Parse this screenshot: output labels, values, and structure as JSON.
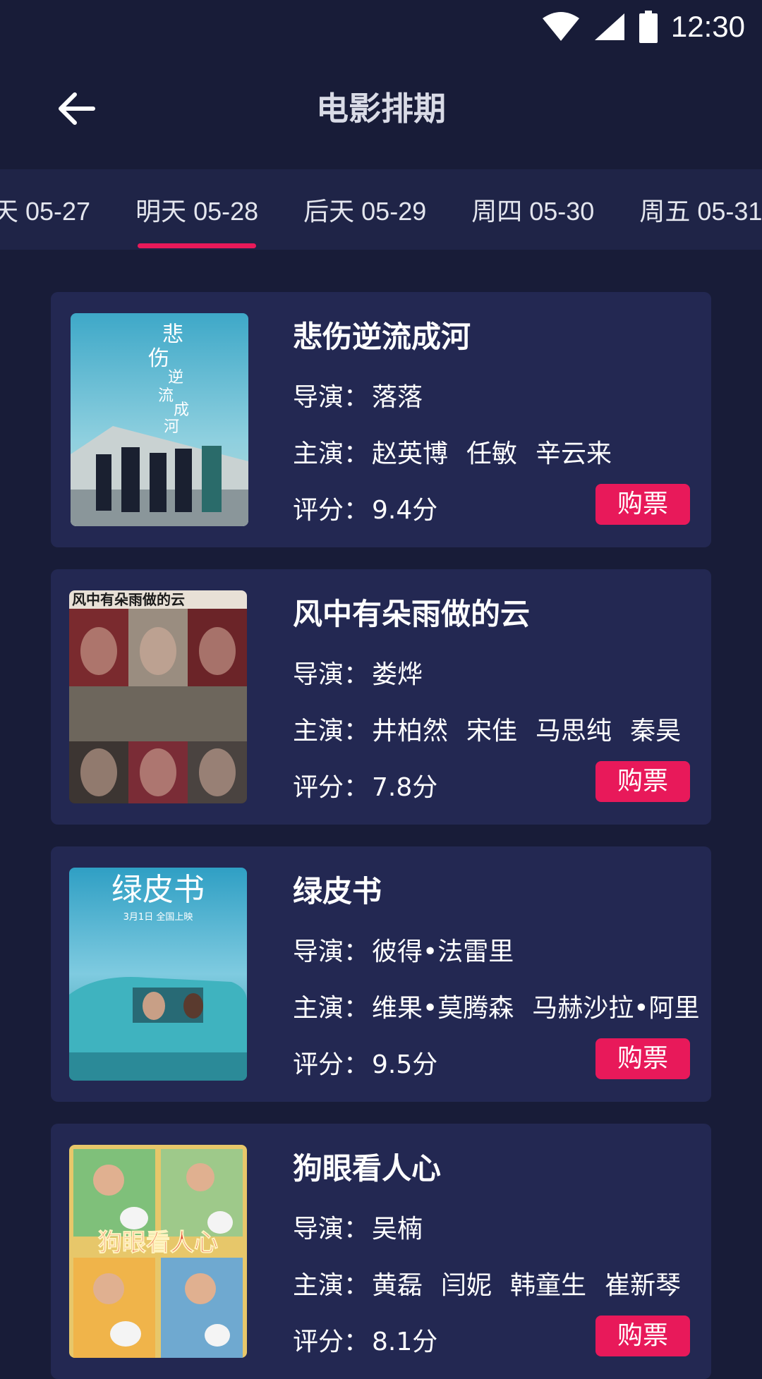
{
  "status_bar": {
    "time": "12:30",
    "icons": [
      "wifi-icon",
      "signal-icon",
      "battery-icon"
    ]
  },
  "header": {
    "title": "电影排期",
    "back_icon": "arrow-left-icon"
  },
  "date_tabs": [
    {
      "label": "天 05-27",
      "active": false
    },
    {
      "label": "明天 05-28",
      "active": true
    },
    {
      "label": "后天 05-29",
      "active": false
    },
    {
      "label": "周四 05-30",
      "active": false
    },
    {
      "label": "周五 05-31",
      "active": false
    }
  ],
  "labels": {
    "director": "导演：",
    "cast": "主演：",
    "rating": "评分：",
    "buy": "购票"
  },
  "movies": [
    {
      "title": "悲伤逆流成河",
      "director": "落落",
      "cast": [
        "赵英博",
        "任敏",
        "辛云来"
      ],
      "rating": "9.4分",
      "poster_text": "悲伤逆流成河"
    },
    {
      "title": "风中有朵雨做的云",
      "director": "娄烨",
      "cast": [
        "井柏然",
        "宋佳",
        "马思纯",
        "秦昊"
      ],
      "rating": "7.8分",
      "poster_text": "风中有朵雨做的云"
    },
    {
      "title": "绿皮书",
      "director": "彼得•法雷里",
      "cast": [
        "维果•莫腾森",
        "马赫沙拉•阿里"
      ],
      "rating": "9.5分",
      "poster_text": "绿皮书",
      "poster_sub": "3月1日 全国上映"
    },
    {
      "title": "狗眼看人心",
      "director": "吴楠",
      "cast": [
        "黄磊",
        "闫妮",
        "韩童生",
        "崔新琴"
      ],
      "rating": "8.1分",
      "poster_text": "狗眼看人心"
    }
  ],
  "colors": {
    "background": "#181c38",
    "card": "#232852",
    "tabbar": "#1f2447",
    "accent": "#e8195a"
  }
}
